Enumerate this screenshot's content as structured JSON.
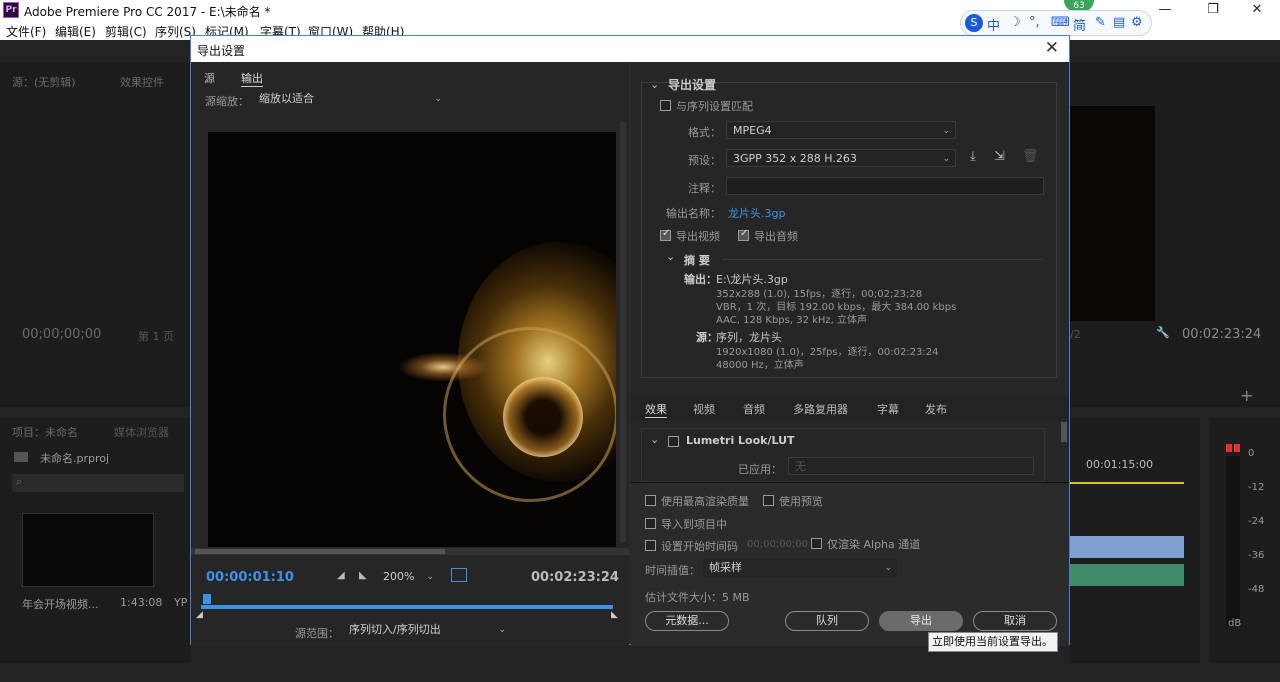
{
  "window": {
    "title": "Adobe Premiere Pro CC 2017 - E:\\未命名 *",
    "app_icon": "Pr",
    "min": "—",
    "max": "❐",
    "close": "✕"
  },
  "menu": [
    "文件(F)",
    "编辑(E)",
    "剪辑(C)",
    "序列(S)",
    "标记(M)",
    "字幕(T)",
    "窗口(W)",
    "帮助(H)"
  ],
  "ime": {
    "lang": "中",
    "mode": "简",
    "badge": "63"
  },
  "background": {
    "source_tab": "源：(无剪辑)",
    "effects_tab": "效果控件",
    "timecode_left": "00;00;00;00",
    "page_label": "第 1 页",
    "project_tab": "项目：未命名",
    "media_tab": "媒体浏览器",
    "project_file": "未命名.prproj",
    "clip_name": "年会开场视频...",
    "clip_dur": "1:43:08",
    "clip_extra": "YP",
    "program_timecode": "00:02:23:24",
    "program_frac": "/2",
    "timeline_time": "00:01:15:00",
    "meter": [
      "0",
      "-12",
      "-24",
      "-36",
      "-48",
      "dB"
    ]
  },
  "dialog": {
    "title": "导出设置",
    "tabs": [
      "源",
      "输出"
    ],
    "source_scaling_label": "源缩放：",
    "source_scaling_value": "缩放以适合",
    "time_current": "00:00:01:10",
    "time_total": "00:02:23:24",
    "zoom": "200%",
    "range_label": "源范围：",
    "range_value": "序列切入/序列切出",
    "export_settings": {
      "section": "导出设置",
      "match_sequence": "与序列设置匹配",
      "format_label": "格式：",
      "format_value": "MPEG4",
      "preset_label": "预设：",
      "preset_value": "3GPP 352 x 288 H.263",
      "comments_label": "注释：",
      "comments_value": "",
      "output_name_label": "输出名称：",
      "output_name_value": "龙片头.3gp",
      "export_video": "导出视频",
      "export_audio": "导出音频"
    },
    "summary": {
      "title": "摘 要",
      "output_label": "输出：",
      "output_lines": [
        "E:\\龙片头.3gp",
        "352x288 (1.0), 15fps，逐行，00;02;23;28",
        "VBR，1 次，目标 192.00 kbps，最大 384.00 kbps",
        "AAC, 128 Kbps, 32 kHz, 立体声"
      ],
      "source_label": "源：",
      "source_lines": [
        "序列，龙片头",
        "1920x1080 (1.0)，25fps，逐行，00:02:23:24",
        "48000 Hz，立体声"
      ]
    },
    "right_tabs": [
      "效果",
      "视频",
      "音频",
      "多路复用器",
      "字幕",
      "发布"
    ],
    "lumetri": {
      "label": "Lumetri Look/LUT",
      "applied_label": "已应用：",
      "applied_value": "无"
    },
    "options": {
      "max_render": "使用最高渲染质量",
      "use_previews": "使用预览",
      "import_project": "导入到项目中",
      "set_start_tc": "设置开始时间码",
      "start_tc_value": "00;00;00;00",
      "alpha_only": "仅渲染 Alpha 通道",
      "interp_label": "时间插值：",
      "interp_value": "帧采样",
      "filesize": "估计文件大小：5 MB"
    },
    "buttons": {
      "metadata": "元数据...",
      "queue": "队列",
      "export": "导出",
      "cancel": "取消"
    },
    "tooltip": "立即使用当前设置导出。"
  }
}
